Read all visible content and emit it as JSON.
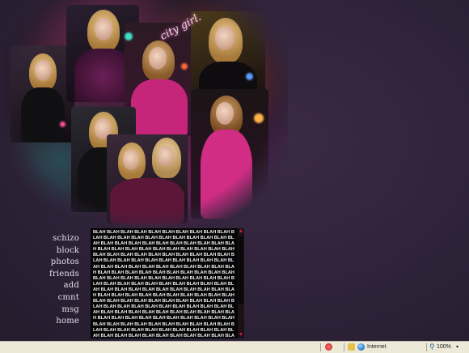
{
  "collage": {
    "tagline": "city girl."
  },
  "nav": {
    "items": [
      "schizo",
      "block",
      "photos",
      "friends",
      "add",
      "cmnt",
      "msg",
      "home"
    ]
  },
  "content": {
    "text": "BLAH BLAH BLAH BLAH BLAH BLAH BLAH BLAH BLAH BLAH BLAH BLAH BLAH BLAH BLAH BLAH BLAH BLAH BLAH BLAH BLAH BLAH BLAH BLAH BLAH BLAH BLAH BLAH BLAH BLAH BLAH BLAH BLAH BLAH BLAH BLAH BLAH BLAH BLAH BLAH BLAH BLAH BLAH BLAH BLAH BLAH BLAH BLAH BLAH BLAH BLAH BLAH BLAH BLAH BLAH BLAH BLAH BLAH BLAH BLAH BLAH BLAH BLAH BLAH BLAH BLAH BLAH BLAH BLAH BLAH BLAH BLAH BLAH BLAH BLAH BLAH BLAH BLAH BLAH BLAH BLAH BLAH BLAH BLAH BLAH BLAH BLAH BLAH BLAH BLAH BLAH BLAH BLAH BLAH BLAH BLAH BLAH BLAH BLAH BLAH BLAH BLAH BLAH BLAH BLAH BLAH BLAH BLAH BLAH BLAH BLAH BLAH BLAH BLAH BLAH BLAH BLAH BLAH BLAH BLAH BLAH BLAH BLAH BLAH BLAH BLAH BLAH BLAH BLAH BLAH BLAH BLAH BLAH BLAH BLAH BLAH BLAH BLAH BLAH BLAH BLAH BLAH BLAH BLAH BLAH BLAH BLAH BLAH BLAH BLAH BLAH BLAH BLAH BLAH BLAH BLAH BLAH BLAH BLAH BLAH BLAH BLAH BLAH BLAH BLAH BLAH BLAH BLAH BLAH BLAH BLAH BLAH BLAH BLAH BLAH BLAH BLAH BLAH BLAH BLAH BLAH BLAH BLAH BLAH BLAH BLAH BLAH BLAH BLAH BLAH BLAH BLAH BLAH BLAH BLAH BLAH BLAH BLAH BLAH BLAH BLAH BLAH BLAH BLAH BLAH BLAH BLAH BLAH BLAH BLAH BLAH BLAH BLAH BLAH BLAH BLAH BLAH BLAH BLAH BLAH BLAH BLAH BLAH BLAH"
  },
  "statusbar": {
    "zone": "Internet",
    "zoom": "100%",
    "zone_icon": "globe-icon",
    "zoom_icon": "magnifier-icon"
  },
  "colors": {
    "background": "#2e2238",
    "scroll_arrow": "#c02040",
    "content_bg": "#050406"
  }
}
